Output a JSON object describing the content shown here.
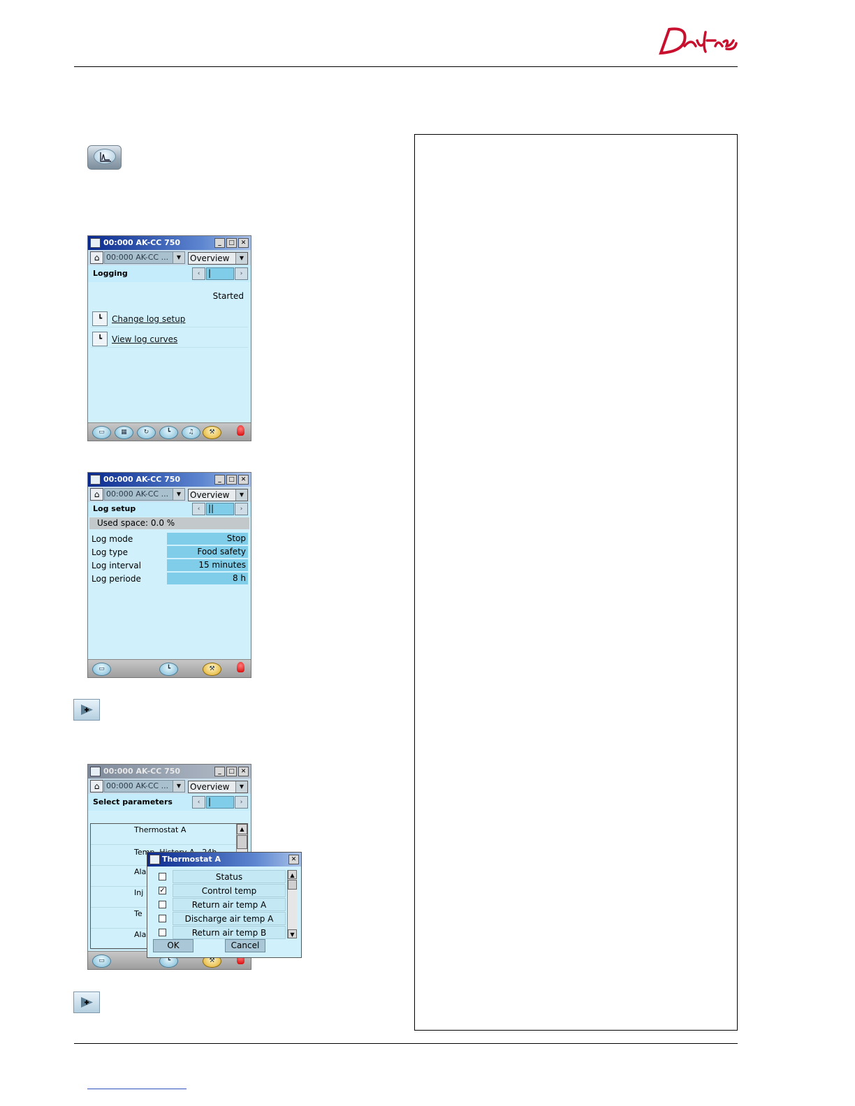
{
  "brand": {
    "logo_text": "Danfoss",
    "logo_color": "#c8102e"
  },
  "window1": {
    "title": "00:000 AK-CC 750",
    "device_select": "00:000 AK-CC ...",
    "view_select": "Overview",
    "page_title": "Logging",
    "status": "Started",
    "links": [
      "Change log setup",
      "View log curves"
    ]
  },
  "window2": {
    "title": "00:000 AK-CC 750",
    "device_select": "00:000 AK-CC ...",
    "view_select": "Overview",
    "page_title": "Log setup",
    "used_space": "Used space: 0.0 %",
    "params": [
      {
        "label": "Log mode",
        "value": "Stop"
      },
      {
        "label": "Log type",
        "value": "Food safety"
      },
      {
        "label": "Log interval",
        "value": "15 minutes"
      },
      {
        "label": "Log periode",
        "value": "8 h"
      }
    ]
  },
  "window3": {
    "title": "00:000 AK-CC 750",
    "device_select": "00:000 AK-CC ...",
    "view_select": "Overview",
    "page_title": "Select parameters",
    "list_items": [
      "Thermostat A",
      "Temp. History A - 24h",
      "Ala",
      "Inj",
      "Te",
      "Ala"
    ]
  },
  "dialog": {
    "title": "Thermostat A",
    "options": [
      {
        "label": "Status",
        "checked": false
      },
      {
        "label": "Control temp",
        "checked": true
      },
      {
        "label": "Return air temp A",
        "checked": false
      },
      {
        "label": "Discharge air temp A",
        "checked": false
      },
      {
        "label": "Return air temp B",
        "checked": false
      }
    ],
    "ok": "OK",
    "cancel": "Cancel"
  }
}
